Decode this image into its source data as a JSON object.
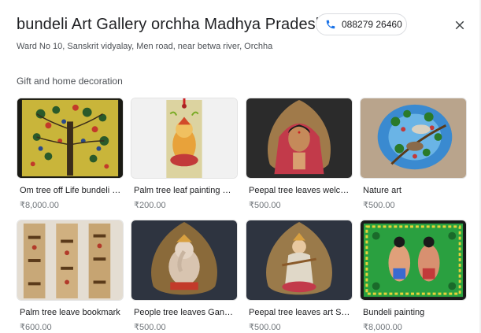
{
  "header": {
    "title": "bundeli Art Gallery orchha Madhya Pradesh",
    "phone": "088279 26460",
    "address": "Ward No 10, Sanskrit vidyalay, Men road, near betwa river, Orchha"
  },
  "section": {
    "title": "Gift and home decoration"
  },
  "products": [
    {
      "name": "Om tree off Life bundeli painting",
      "price": "₹8,000.00",
      "image": "tree-of-life-painting"
    },
    {
      "name": "Palm tree leaf painting Ganesha",
      "price": "₹200.00",
      "image": "ganesha-bookmark"
    },
    {
      "name": "Peepal tree leaves welcome",
      "price": "₹500.00",
      "image": "welcome-woman-leaf"
    },
    {
      "name": "Nature art",
      "price": "₹500.00",
      "image": "birds-nature-painting"
    },
    {
      "name": "Palm tree leave bookmark",
      "price": "₹600.00",
      "image": "palm-leaf-bookmarks"
    },
    {
      "name": "People tree leaves Ganesha",
      "price": "₹500.00",
      "image": "ganesha-leaf"
    },
    {
      "name": "Peepal tree leaves art Saraswati",
      "price": "₹500.00",
      "image": "saraswati-leaf"
    },
    {
      "name": "Bundeli painting",
      "price": "₹8,000.00",
      "image": "bundeli-painting-green"
    }
  ],
  "colors": {
    "phone_icon": "#1a73e8",
    "price": "#70757a"
  }
}
